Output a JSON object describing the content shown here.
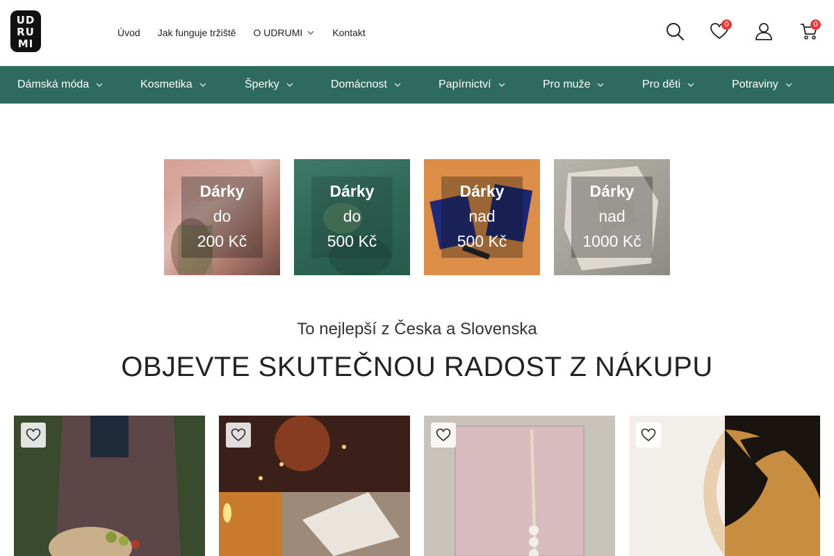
{
  "header": {
    "logo_lines": [
      "UD",
      "RU",
      "MI"
    ],
    "nav": [
      {
        "label": "Úvod"
      },
      {
        "label": "Jak funguje tržiště"
      },
      {
        "label": "O UDRUMI",
        "has_dropdown": true
      },
      {
        "label": "Kontakt"
      }
    ],
    "icons": {
      "search": "search-icon",
      "wishlist": "heart-icon",
      "account": "user-icon",
      "cart": "cart-icon"
    },
    "wishlist_count": "0",
    "cart_count": "0"
  },
  "categories": [
    {
      "label": "Dámská móda"
    },
    {
      "label": "Kosmetika"
    },
    {
      "label": "Šperky"
    },
    {
      "label": "Domácnost"
    },
    {
      "label": "Papírnictví"
    },
    {
      "label": "Pro muže"
    },
    {
      "label": "Pro děti"
    },
    {
      "label": "Potraviny"
    }
  ],
  "gift_tiles": [
    {
      "line1": "Dárky",
      "line2": "do",
      "line3": "200 Kč"
    },
    {
      "line1": "Dárky",
      "line2": "do",
      "line3": "500 Kč"
    },
    {
      "line1": "Dárky",
      "line2": "nad",
      "line3": "500 Kč"
    },
    {
      "line1": "Dárky",
      "line2": "nad",
      "line3": "1000 Kč"
    }
  ],
  "section": {
    "subtitle": "To nejlepší z Česka a Slovenska",
    "title": "OBJEVTE SKUTEČNOU RADOST Z NÁKUPU"
  },
  "colors": {
    "brand_green": "#2e6b5c",
    "badge_red": "#e23b3b"
  }
}
